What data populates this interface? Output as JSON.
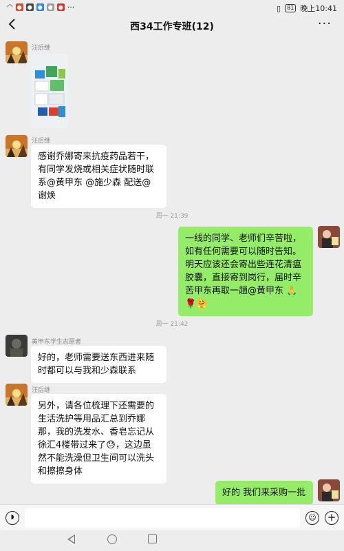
{
  "status_bar": {
    "battery": "81",
    "time": "晚上10:41"
  },
  "header": {
    "title": "西34工作专班(12)",
    "back_icon": "chevron-left-icon",
    "more_label": "···"
  },
  "messages": {
    "m1": {
      "sender": "汪后继",
      "type": "image"
    },
    "m2": {
      "sender": "汪后继",
      "text": "感谢乔娜寄来抗疫药品若干，有同学发烧或相关症状随时联系@黄甲东 @施少森  配送@谢焕"
    },
    "ts1": "周一 21:39",
    "m3": {
      "text": "一线的同学、老师们辛苦啦，如有任何需要可以随时告知。明天应该还会寄出些连花清瘟胶囊，直接寄到岗行，届时辛苦甲东再取一趟@黄甲东 🙏🌹🤗"
    },
    "ts2": "周一 21:42",
    "m4": {
      "sender": "黄甲东学生志愿者",
      "text": "好的，老师需要送东西进来随时都可以与我和少森联系"
    },
    "m5": {
      "sender": "汪后继",
      "text": "另外，请各位梳理下还需要的生活洗护等用品汇总到乔娜那，我的洗发水、香皂忘记从徐汇4楼带过来了😓，这边虽然不能洗澡但卫生间可以洗头和擦擦身体"
    },
    "m6": {
      "text": "好的 我们来采购一批"
    }
  },
  "input_bar": {
    "voice_icon": "voice-icon",
    "emoji_icon": "emoji-icon",
    "plus_icon": "plus-icon"
  }
}
